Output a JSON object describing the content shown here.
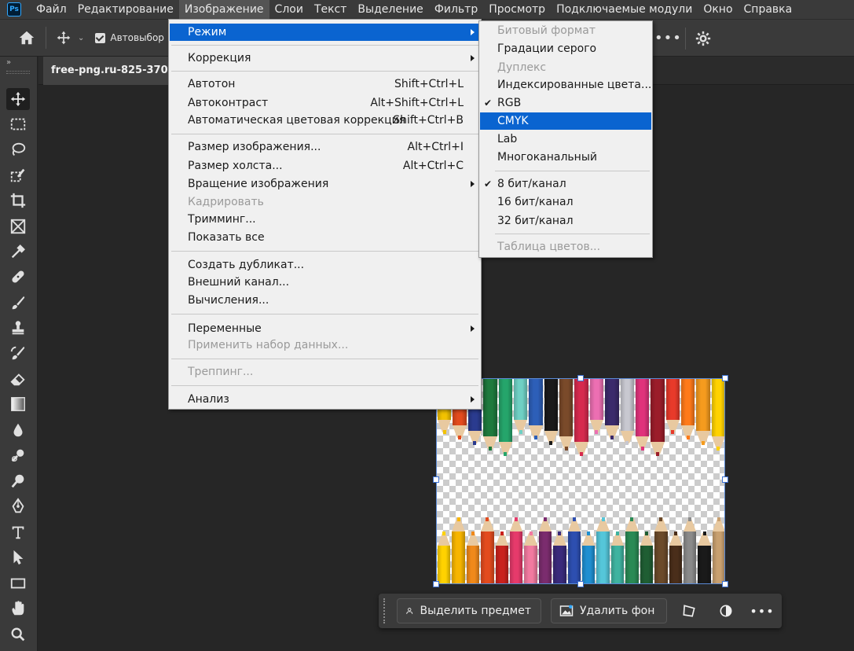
{
  "menubar": {
    "logo": "Ps",
    "items": [
      "Файл",
      "Редактирование",
      "Изображение",
      "Слои",
      "Текст",
      "Выделение",
      "Фильтр",
      "Просмотр",
      "Подключаемые модули",
      "Окно",
      "Справка"
    ]
  },
  "options_bar": {
    "auto_select_label": "Автовыбор"
  },
  "document": {
    "tab_title": "free-png.ru-825-370x200"
  },
  "image_menu": {
    "items": [
      {
        "label": "Режим",
        "shortcut": "",
        "submenu": true,
        "disabled": false,
        "highlighted": true
      },
      {
        "label": "Коррекция",
        "shortcut": "",
        "submenu": true,
        "disabled": false
      },
      {
        "label": "Автотон",
        "shortcut": "Shift+Ctrl+L",
        "submenu": false,
        "disabled": false
      },
      {
        "label": "Автоконтраст",
        "shortcut": "Alt+Shift+Ctrl+L",
        "submenu": false,
        "disabled": false
      },
      {
        "label": "Автоматическая цветовая коррекция",
        "shortcut": "Shift+Ctrl+B",
        "submenu": false,
        "disabled": false
      },
      {
        "label": "Размер изображения...",
        "shortcut": "Alt+Ctrl+I",
        "submenu": false,
        "disabled": false
      },
      {
        "label": "Размер холста...",
        "shortcut": "Alt+Ctrl+C",
        "submenu": false,
        "disabled": false
      },
      {
        "label": "Вращение изображения",
        "shortcut": "",
        "submenu": true,
        "disabled": false
      },
      {
        "label": "Кадрировать",
        "shortcut": "",
        "submenu": false,
        "disabled": true
      },
      {
        "label": "Тримминг...",
        "shortcut": "",
        "submenu": false,
        "disabled": false
      },
      {
        "label": "Показать все",
        "shortcut": "",
        "submenu": false,
        "disabled": false
      },
      {
        "label": "Создать дубликат...",
        "shortcut": "",
        "submenu": false,
        "disabled": false
      },
      {
        "label": "Внешний канал...",
        "shortcut": "",
        "submenu": false,
        "disabled": false
      },
      {
        "label": "Вычисления...",
        "shortcut": "",
        "submenu": false,
        "disabled": false
      },
      {
        "label": "Переменные",
        "shortcut": "",
        "submenu": true,
        "disabled": false
      },
      {
        "label": "Применить набор данных...",
        "shortcut": "",
        "submenu": false,
        "disabled": true
      },
      {
        "label": "Треппинг...",
        "shortcut": "",
        "submenu": false,
        "disabled": true
      },
      {
        "label": "Анализ",
        "shortcut": "",
        "submenu": true,
        "disabled": false
      }
    ]
  },
  "mode_submenu": {
    "items": [
      {
        "label": "Битовый формат",
        "checked": false,
        "disabled": true
      },
      {
        "label": "Градации серого",
        "checked": false,
        "disabled": false
      },
      {
        "label": "Дуплекс",
        "checked": false,
        "disabled": true
      },
      {
        "label": "Индексированные цвета...",
        "checked": false,
        "disabled": false
      },
      {
        "label": "RGB",
        "checked": true,
        "disabled": false
      },
      {
        "label": "CMYK",
        "checked": false,
        "disabled": false,
        "highlighted": true
      },
      {
        "label": "Lab",
        "checked": false,
        "disabled": false
      },
      {
        "label": "Многоканальный",
        "checked": false,
        "disabled": false
      },
      {
        "label": "8 бит/канал",
        "checked": true,
        "disabled": false
      },
      {
        "label": "16 бит/канал",
        "checked": false,
        "disabled": false
      },
      {
        "label": "32 бит/канал",
        "checked": false,
        "disabled": false
      },
      {
        "label": "Таблица цветов...",
        "checked": false,
        "disabled": true
      }
    ]
  },
  "context_bar": {
    "select_subject": "Выделить предмет",
    "remove_bg": "Удалить фон"
  },
  "colors": {
    "accent": "#0a64d0",
    "pencils_top": [
      "#f2c200",
      "#e34b1e",
      "#2a3b8f",
      "#1f7a3d",
      "#25a56b",
      "#6fd0c4",
      "#2d5fb8",
      "#1a1a1a",
      "#7a4a2a",
      "#d62a4e",
      "#ec6fb2",
      "#3b2a6b",
      "#c8c8d0",
      "#e0337b",
      "#9b1d2a",
      "#e83a2a",
      "#ff7a1a",
      "#f59b1e",
      "#ffd200"
    ],
    "pencils_bottom": [
      "#ffd200",
      "#f7b500",
      "#f0891a",
      "#e34b1e",
      "#c9221e",
      "#e63a6b",
      "#f27aa0",
      "#7b2c6e",
      "#3a2a7b",
      "#2d4fb0",
      "#1f8fd1",
      "#55c6d9",
      "#3fb3a0",
      "#2a8a55",
      "#1f5e33",
      "#6b4a2a",
      "#4a2e1a",
      "#8a8a8a",
      "#1a1a1a",
      "#c8a070"
    ]
  }
}
